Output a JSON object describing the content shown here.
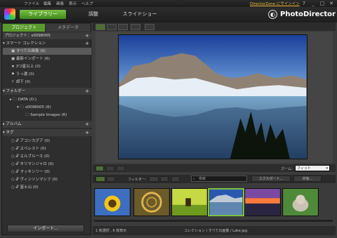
{
  "menu": [
    "ファイル",
    "編集",
    "画像",
    "表示",
    "ヘルプ"
  ],
  "directorzone": "DirectorZone にサインイン",
  "window_buttons": [
    "?",
    "_",
    "□",
    "✕"
  ],
  "modes": {
    "library": "ライブラリー",
    "adjust": "調整",
    "slideshow": "スライドショー"
  },
  "brand": "PhotoDirector",
  "left_tabs": {
    "project": "プロジェクト",
    "metadata": "メタデータ"
  },
  "project_row": "プロジェクト：s0098005",
  "smart_collection": {
    "title": "スマート コレクション",
    "items": [
      "すべての画像 (6)",
      "最新インポート (6)",
      "3つ星以上 (0)",
      "うっ選 (0)",
      "却下 (0)"
    ]
  },
  "folders": {
    "title": "フォルダー",
    "items": [
      "DATA (D:)",
      "s0098005 (6)",
      "Sample Images (6)"
    ]
  },
  "album": "アルバム",
  "tags": {
    "title": "タグ",
    "items": [
      "アコンカグア (0)",
      "エベレスト (0)",
      "エルブルース (0)",
      "キリマンジャロ (0)",
      "マッキンリー (0)",
      "ヴィンソンマシフ (0)",
      "富士山 (0)"
    ]
  },
  "import_button": "インポート...",
  "zoom": {
    "label": "ズーム:",
    "value": "フィット"
  },
  "filter_label": "フィルター:",
  "search_placeholder": "検索",
  "export_button": "エクスポート...",
  "share_button": "共有...",
  "status": {
    "left": "1 枚選択 , 6 枚表示",
    "center": "コレクション / すべての画像 / Lake.jpg"
  },
  "icons": [
    "plus-icon",
    "folder-icon",
    "tag-icon",
    "search-icon",
    "chevron-down-icon"
  ],
  "colors": {
    "accent": "#5a9a2c",
    "highlight": "#7ac043"
  }
}
